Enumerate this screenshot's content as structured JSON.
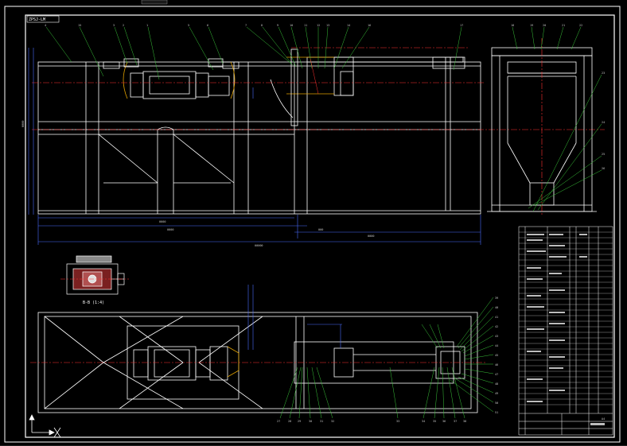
{
  "drawing": {
    "title_block_label": "ZPSJ-LM",
    "section_label": "B-B (1:4)",
    "table_header": "A4"
  },
  "colors": {
    "background": "#000000",
    "line": "#ffffff",
    "center": "#ff3030",
    "dim": "#4a6cff",
    "leader": "#39c339",
    "hidden": "#e0a000"
  },
  "icons": {
    "ucs": "ucs-axis-icon"
  }
}
